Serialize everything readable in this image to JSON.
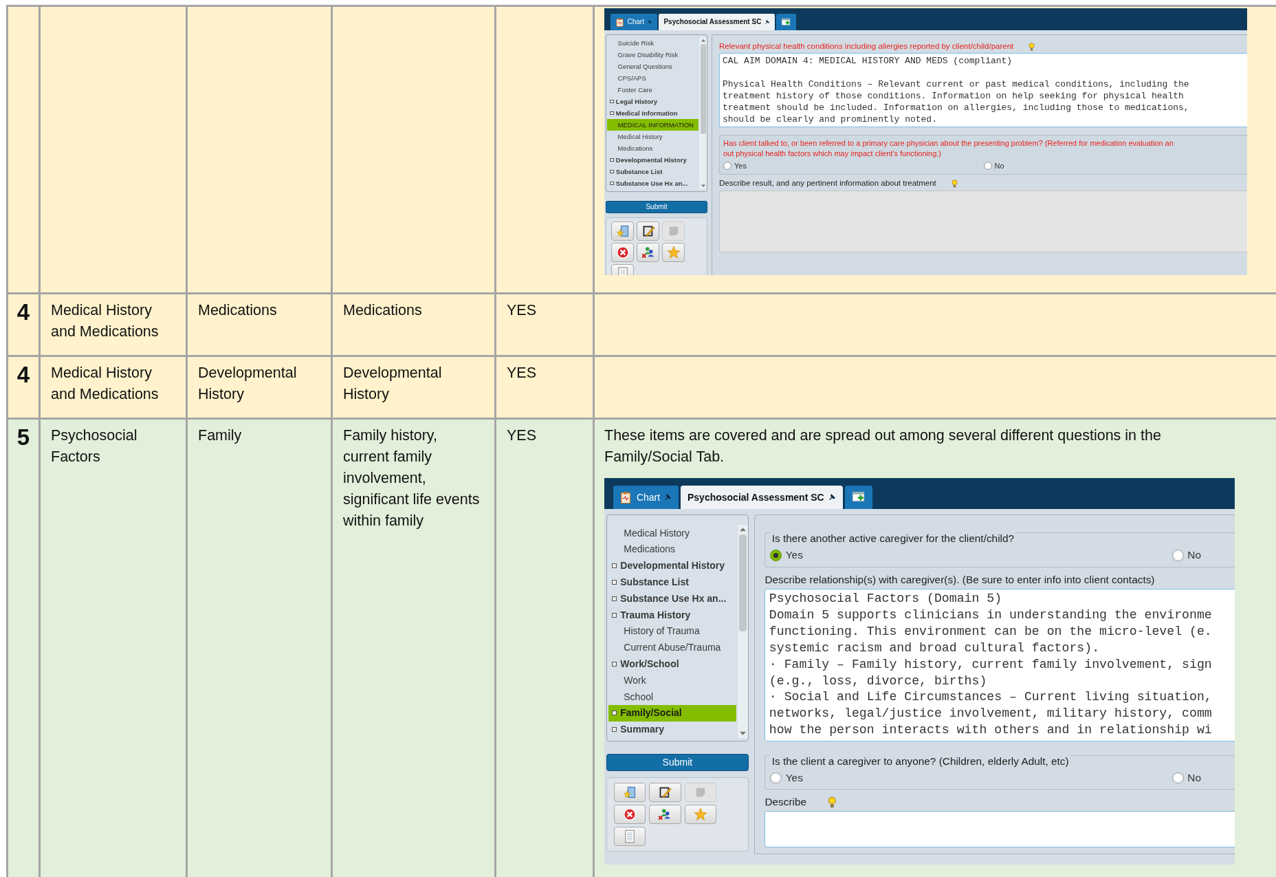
{
  "table": {
    "rows": [
      {
        "color": "#fff2cc",
        "column_6": {
          "screenshot": {
            "tabs": [
              {
                "kind": "chart",
                "label": "Chart",
                "selected": false
              },
              {
                "kind": "form",
                "label": "Psychosocial Assessment SC",
                "selected": true
              },
              {
                "kind": "add",
                "selected": false
              }
            ],
            "nav": [
              {
                "kind": "item",
                "label": "Suicide Risk",
                "selected": false
              },
              {
                "kind": "item",
                "label": "Grave Disability Risk",
                "selected": false
              },
              {
                "kind": "item",
                "label": "General Questions",
                "selected": false
              },
              {
                "kind": "item",
                "label": "CPS/APS",
                "selected": false
              },
              {
                "kind": "item",
                "label": "Foster Care",
                "selected": false
              },
              {
                "kind": "section",
                "label": "Legal History",
                "selected": false
              },
              {
                "kind": "section",
                "label": "Medical Information",
                "selected": false
              },
              {
                "kind": "item",
                "label": "MEDICAL INFORMATION",
                "selected": true
              },
              {
                "kind": "item",
                "label": "Medical History",
                "selected": false
              },
              {
                "kind": "item",
                "label": "Medications",
                "selected": false
              },
              {
                "kind": "section",
                "label": "Developmental History",
                "selected": false
              },
              {
                "kind": "section",
                "label": "Substance List",
                "selected": false
              },
              {
                "kind": "section",
                "label": "Substance Use Hx an...",
                "selected": false
              }
            ],
            "submit": "Submit",
            "toolbar": [
              {
                "disabled": false
              },
              {
                "disabled": false
              },
              {
                "disabled": true
              },
              {
                "disabled": false
              },
              {
                "disabled": false
              },
              {
                "disabled": false
              },
              {
                "disabled": false
              }
            ],
            "form": [
              {
                "kind": "textarea",
                "label": "Relevant physical health conditions including allergies reported by client/child/parent",
                "required": true,
                "hint": true,
                "disabled": false,
                "paragraphs": [
                  [
                    "CAL AIM DOMAIN 4: MEDICAL HISTORY AND MEDS (compliant)"
                  ],
                  [
                    "Physical Health Conditions – Relevant current or past medical conditions, including the",
                    "treatment history of those conditions. Information on help seeking for physical health",
                    "treatment should be included. Information on allergies, including those to medications,",
                    "should be clearly and prominently noted."
                  ]
                ]
              },
              {
                "kind": "radio_box",
                "question_lines": [
                  "Has client talked to, or been referred to a primary care physician about the presenting problem? (Referred for medication evaluation an",
                  "out physical health factors which may impact client's functioning.)"
                ],
                "required": true,
                "hint": false,
                "options": [
                  {
                    "label": "Yes",
                    "selected": false
                  },
                  {
                    "label": "No",
                    "selected": false
                  }
                ]
              },
              {
                "kind": "textarea",
                "label": "Describe result, and any pertinent information about treatment",
                "required": false,
                "hint": true,
                "disabled": true
              }
            ]
          }
        }
      },
      {
        "color": "#fff2cc",
        "column_1": "4",
        "column_2": "Medical History and Medications",
        "column_3": "Medications",
        "column_4": "Medications",
        "column_5": "YES"
      },
      {
        "color": "#fff2cc",
        "column_1": "4",
        "column_2": "Medical History and Medications",
        "column_3": "Developmental History",
        "column_4": "Developmental History",
        "column_5": "YES"
      },
      {
        "color": "#e2efda",
        "column_1": "5",
        "column_2": "Psychosocial Factors",
        "column_3": "Family",
        "column_4": "Family history, current family involvement, significant life events within family",
        "column_5": "YES",
        "column_6": {
          "text": "These items are covered and are spread out among several different questions in the Family/Social Tab.",
          "screenshot": {
            "tabs": [
              {
                "kind": "chart",
                "label": "Chart",
                "selected": false
              },
              {
                "kind": "form",
                "label": "Psychosocial Assessment SC",
                "selected": true
              },
              {
                "kind": "add",
                "selected": false
              }
            ],
            "nav": [
              {
                "kind": "item",
                "label": "Medical History",
                "selected": false
              },
              {
                "kind": "item",
                "label": "Medications",
                "selected": false
              },
              {
                "kind": "section",
                "label": "Developmental History",
                "selected": false
              },
              {
                "kind": "section",
                "label": "Substance List",
                "selected": false
              },
              {
                "kind": "section",
                "label": "Substance Use Hx an...",
                "selected": false
              },
              {
                "kind": "section",
                "label": "Trauma History",
                "selected": false
              },
              {
                "kind": "item",
                "label": "History of Trauma",
                "selected": false
              },
              {
                "kind": "item",
                "label": "Current Abuse/Trauma",
                "selected": false
              },
              {
                "kind": "section",
                "label": "Work/School",
                "selected": false
              },
              {
                "kind": "item",
                "label": "Work",
                "selected": false
              },
              {
                "kind": "item",
                "label": "School",
                "selected": false
              },
              {
                "kind": "section",
                "label": "Family/Social",
                "selected": true
              },
              {
                "kind": "section",
                "label": "Summary",
                "selected": false
              }
            ],
            "submit": "Submit",
            "toolbar": [
              {
                "disabled": false
              },
              {
                "disabled": false
              },
              {
                "disabled": true
              },
              {
                "disabled": false
              },
              {
                "disabled": false
              },
              {
                "disabled": false
              },
              {
                "disabled": false
              }
            ],
            "form": [
              {
                "kind": "radio_group",
                "question_lines": [
                  "Is there another active caregiver for the client/child?"
                ],
                "required": false,
                "hint": false,
                "options": [
                  {
                    "label": "Yes",
                    "selected": true
                  },
                  {
                    "label": "No",
                    "selected": false
                  }
                ]
              },
              {
                "kind": "textarea",
                "label": "Describe relationship(s) with caregiver(s). (Be sure to enter info into client contacts)",
                "required": false,
                "hint": false,
                "disabled": false,
                "paragraphs": [
                  [
                    "Psychosocial Factors (Domain 5)",
                    "Domain 5 supports clinicians in understanding the environme",
                    "functioning. This environment can be on the micro-level (e.",
                    "systemic racism and broad cultural factors).",
                    "· Family – Family history, current family involvement, sign",
                    "(e.g., loss, divorce, births)",
                    "· Social and Life Circumstances – Current living situation,",
                    "networks, legal/justice involvement, military history, comm",
                    "how the person interacts with others and in relationship wi"
                  ]
                ]
              },
              {
                "kind": "radio_group",
                "question_lines": [
                  "Is the client a caregiver to anyone? (Children, elderly Adult, etc)"
                ],
                "required": false,
                "hint": false,
                "options": [
                  {
                    "label": "Yes",
                    "selected": false
                  },
                  {
                    "label": "No",
                    "selected": false
                  }
                ]
              },
              {
                "kind": "textarea",
                "label": "Describe",
                "required": false,
                "hint": true,
                "disabled": false
              }
            ]
          }
        }
      }
    ]
  }
}
